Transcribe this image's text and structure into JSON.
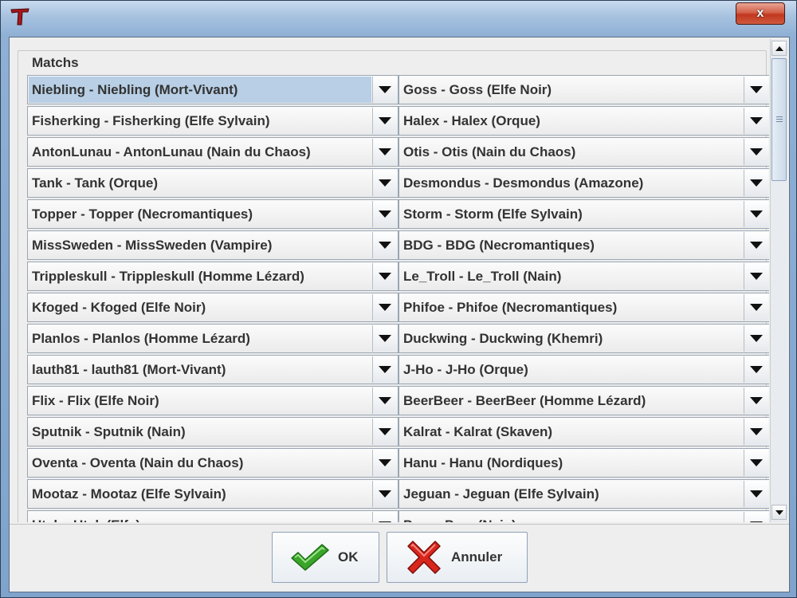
{
  "window": {
    "title": "",
    "close_label": "x"
  },
  "group": {
    "title": "Matchs"
  },
  "matches": [
    {
      "left": "Niebling - Niebling (Mort-Vivant)",
      "right": "Goss - Goss (Elfe Noir)"
    },
    {
      "left": "Fisherking - Fisherking (Elfe Sylvain)",
      "right": "Halex - Halex (Orque)"
    },
    {
      "left": "AntonLunau - AntonLunau (Nain du Chaos)",
      "right": "Otis - Otis (Nain du Chaos)"
    },
    {
      "left": "Tank - Tank (Orque)",
      "right": "Desmondus - Desmondus (Amazone)"
    },
    {
      "left": "Topper - Topper (Necromantiques)",
      "right": "Storm - Storm (Elfe Sylvain)"
    },
    {
      "left": "MissSweden - MissSweden (Vampire)",
      "right": "BDG - BDG (Necromantiques)"
    },
    {
      "left": "Trippleskull - Trippleskull (Homme Lézard)",
      "right": "Le_Troll - Le_Troll (Nain)"
    },
    {
      "left": "Kfoged - Kfoged (Elfe Noir)",
      "right": "Phifoe - Phifoe (Necromantiques)"
    },
    {
      "left": "Planlos - Planlos (Homme Lézard)",
      "right": "Duckwing - Duckwing (Khemri)"
    },
    {
      "left": "lauth81 - lauth81 (Mort-Vivant)",
      "right": "J-Ho - J-Ho (Orque)"
    },
    {
      "left": "Flix - Flix (Elfe Noir)",
      "right": "BeerBeer - BeerBeer (Homme Lézard)"
    },
    {
      "left": "Sputnik - Sputnik (Nain)",
      "right": "Kalrat - Kalrat (Skaven)"
    },
    {
      "left": "Oventa - Oventa (Nain du Chaos)",
      "right": "Hanu - Hanu (Nordiques)"
    },
    {
      "left": "Mootaz - Mootaz (Elfe Sylvain)",
      "right": "Jeguan - Jeguan (Elfe Sylvain)"
    },
    {
      "left": "Utak - Utak (Elfe)",
      "right": "Pera - Pera (Nain)"
    }
  ],
  "buttons": {
    "ok_label": "OK",
    "cancel_label": "Annuler"
  },
  "colors": {
    "selection": "#b8cfe5",
    "ok_check": "#3aa52a",
    "cancel_x": "#d9261c"
  }
}
